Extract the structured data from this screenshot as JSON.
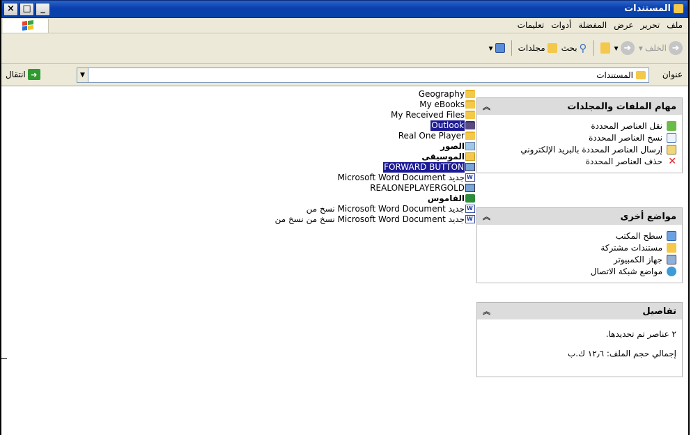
{
  "window": {
    "title": "المستندات"
  },
  "titlebar_buttons": {
    "close": "×",
    "maximize": "□",
    "minimize": "_"
  },
  "menu": [
    "ملف",
    "تحرير",
    "عرض",
    "المفضلة",
    "أدوات",
    "تعليمات"
  ],
  "toolbar": {
    "back": "الخلف",
    "search": "بحث",
    "folders": "مجلدات"
  },
  "address": {
    "label": "عنوان",
    "value": "المستندات",
    "go": "انتقال"
  },
  "panels": {
    "file_tasks": {
      "title": "مهام الملفات والمجلدات",
      "items": [
        {
          "label": "نقل العناصر المحددة",
          "icon": "move-icon"
        },
        {
          "label": "نسخ العناصر المحددة",
          "icon": "copy-icon"
        },
        {
          "label": "إرسال العناصر المحددة بالبريد الإلكتروني",
          "icon": "email-icon"
        },
        {
          "label": "حذف العناصر المحددة",
          "icon": "delete-icon"
        }
      ]
    },
    "other_places": {
      "title": "مواضع أخرى",
      "items": [
        {
          "label": "سطح المكتب",
          "icon": "desktop-icon"
        },
        {
          "label": "مستندات مشتركة",
          "icon": "shared-folder-icon"
        },
        {
          "label": "جهاز الكمبيوتر",
          "icon": "computer-icon"
        },
        {
          "label": "مواضع شبكة الاتصال",
          "icon": "network-icon"
        }
      ]
    },
    "details": {
      "title": "تفاصيل",
      "lines": [
        "٢ عناصر تم تحديدها.",
        "إجمالي حجم الملف: ١٢٫٦ ك.ب"
      ]
    }
  },
  "files": [
    {
      "name": "Geography",
      "icon": "folder-icon",
      "selected": false
    },
    {
      "name": "My eBooks",
      "icon": "folder-icon",
      "selected": false
    },
    {
      "name": "My Received Files",
      "icon": "folder-icon",
      "selected": false
    },
    {
      "name": "Outlook",
      "icon": "folder-icon",
      "selected": true
    },
    {
      "name": "Real One Player",
      "icon": "folder-icon",
      "selected": false
    },
    {
      "name": "الصور",
      "icon": "pictures-folder-icon",
      "selected": false
    },
    {
      "name": "الموسيقى",
      "icon": "music-folder-icon",
      "selected": false
    },
    {
      "name": "FORWARD BUTTON",
      "icon": "app-icon",
      "selected": true
    },
    {
      "name": "Microsoft Word Document جديد",
      "icon": "word-doc-icon",
      "selected": false
    },
    {
      "name": "REALONEPLAYERGOLD",
      "icon": "installer-icon",
      "selected": false
    },
    {
      "name": "القاموس",
      "icon": "dictionary-icon",
      "selected": false
    },
    {
      "name": "نسخ من Microsoft Word Document جديد",
      "icon": "word-doc-icon",
      "selected": false
    },
    {
      "name": "نسخ من نسخ من Microsoft Word Document جديد",
      "icon": "word-doc-icon",
      "selected": false
    }
  ]
}
